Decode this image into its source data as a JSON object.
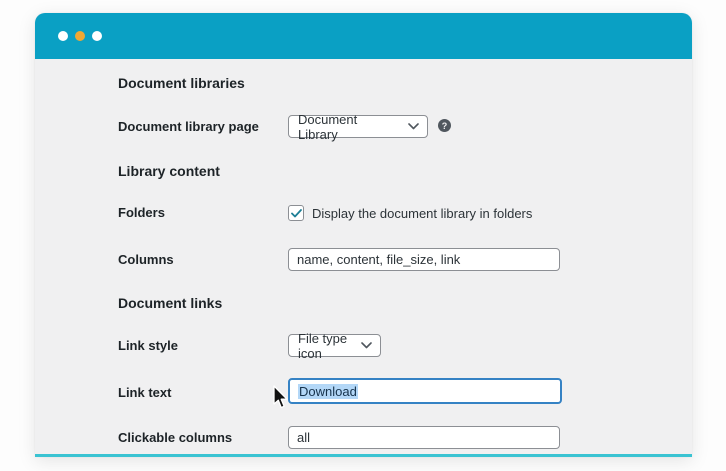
{
  "window": {
    "dots": [
      "white",
      "orange",
      "white"
    ],
    "colors": {
      "titlebar_teal": "#0aa0c4",
      "bottom_line_teal": "#3ac3d2",
      "dot_orange": "#f0a832",
      "body_gray": "#f0f0f1",
      "focus_blue": "#3582c4",
      "selection_blue": "#b3d7f7",
      "check_teal": "#1d7f96"
    }
  },
  "icons": {
    "help_glyph": "?",
    "chevron": "chevron-down",
    "check": "checkmark",
    "pointer": "mouse-arrow"
  },
  "form": {
    "sections": [
      {
        "heading": "Document libraries",
        "rows": [
          {
            "label": "Document library page",
            "type": "select",
            "value": "Document Library",
            "help": true
          }
        ]
      },
      {
        "heading": "Library content",
        "rows": [
          {
            "label": "Folders",
            "type": "checkbox",
            "checked": true,
            "option_text": "Display the document library in folders"
          },
          {
            "label": "Columns",
            "type": "text",
            "value": "name, content, file_size, link"
          }
        ]
      },
      {
        "heading": "Document links",
        "rows": [
          {
            "label": "Link style",
            "type": "select",
            "value": "File type icon"
          },
          {
            "label": "Link text",
            "type": "text",
            "value": "Download",
            "state": "focused, text selected"
          },
          {
            "label": "Clickable columns",
            "type": "text",
            "value": "all"
          }
        ]
      }
    ]
  }
}
